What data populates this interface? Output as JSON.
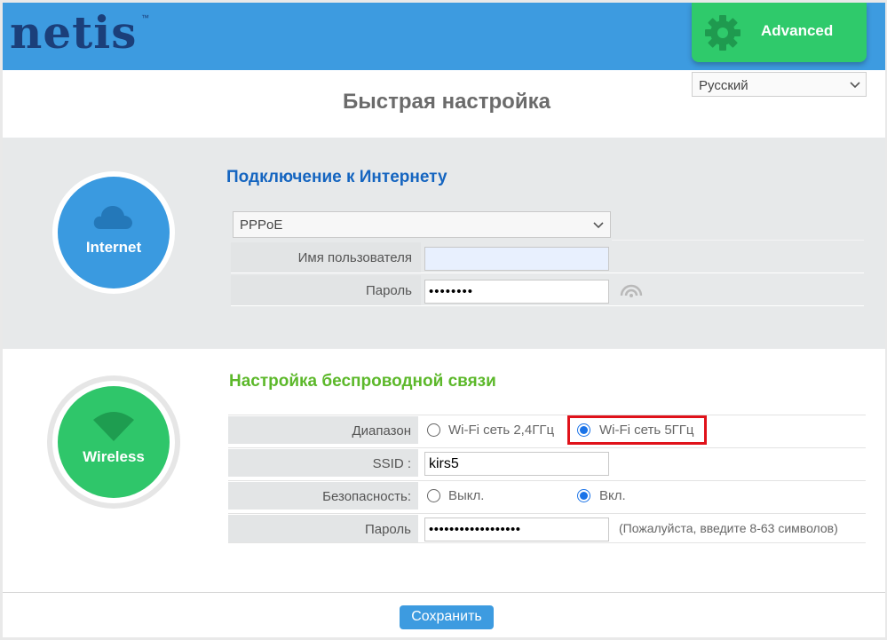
{
  "header": {
    "logo_text": "netis",
    "logo_tm": "™",
    "advanced_label": "Advanced",
    "brand_color": "#3d9be0",
    "advanced_color": "#2fca6b"
  },
  "language": {
    "selected": "Русский"
  },
  "page_title": "Быстрая настройка",
  "internet": {
    "circle_label": "Internet",
    "title": "Подключение к Интернету",
    "title_color": "#1565c0",
    "connection_type": "PPPoE",
    "username_label": "Имя пользователя",
    "username_value": "",
    "password_label": "Пароль",
    "password_value": "••••••••"
  },
  "wireless": {
    "circle_label": "Wireless",
    "title": "Настройка беспроводной связи",
    "title_color": "#5cb82a",
    "band_label": "Диапазон",
    "band_options": [
      {
        "label": "Wi-Fi сеть 2,4ГГц",
        "selected": false
      },
      {
        "label": "Wi-Fi сеть 5ГГц",
        "selected": true
      }
    ],
    "ssid_label": "SSID :",
    "ssid_value": "kirs5",
    "security_label": "Безопасность:",
    "security_options": [
      {
        "label": "Выкл.",
        "selected": false
      },
      {
        "label": "Вкл.",
        "selected": true
      }
    ],
    "password_label": "Пароль",
    "password_value": "••••••••••••••••••",
    "password_hint": "(Пожалуйста, введите 8-63 символов)"
  },
  "footer": {
    "save_label": "Сохранить"
  }
}
